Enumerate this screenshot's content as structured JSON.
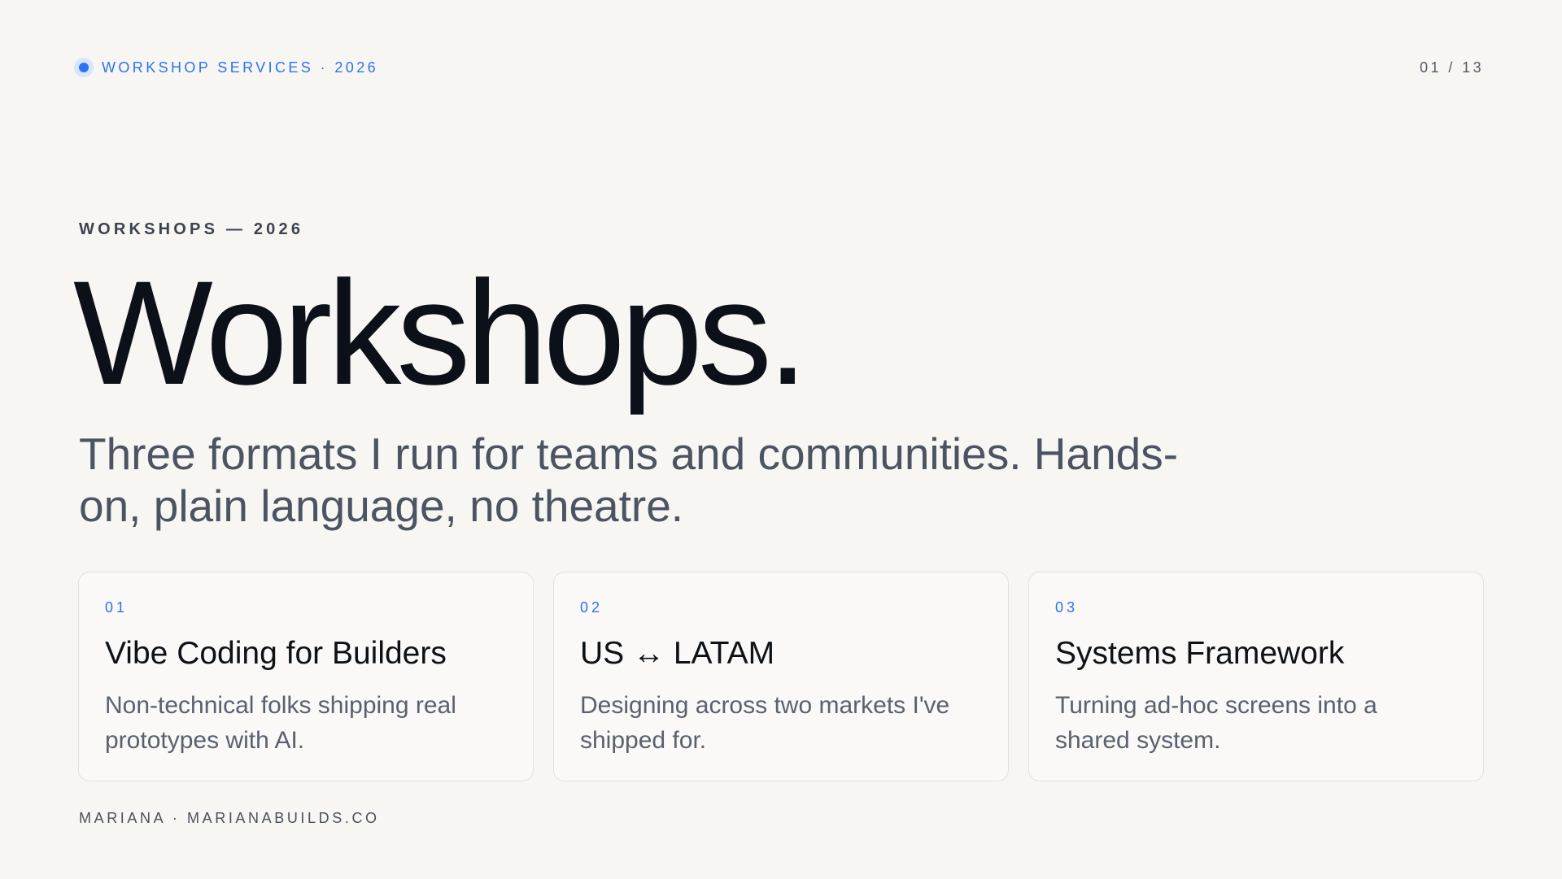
{
  "header": {
    "brand_label": "WORKSHOP SERVICES · 2026",
    "page_counter": "01 / 13"
  },
  "hero": {
    "eyebrow": "WORKSHOPS — 2026",
    "title": "Workshops.",
    "subtitle": "Three formats I run for teams and communities. Hands-on, plain language, no theatre."
  },
  "cards": [
    {
      "number": "01",
      "title": "Vibe Coding for Builders",
      "description": "Non-technical folks shipping real prototypes with AI."
    },
    {
      "number": "02",
      "title": "US ↔ LATAM",
      "description": "Designing across two markets I've shipped for."
    },
    {
      "number": "03",
      "title": "Systems Framework",
      "description": "Turning ad-hoc screens into a shared system."
    }
  ],
  "footer": {
    "credit": "MARIANA · MARIANABUILDS.CO"
  },
  "colors": {
    "accent": "#2d73f0",
    "background": "#f7f6f3",
    "text": "#0c1018"
  },
  "icons": {
    "brand_marker": "dot-icon"
  }
}
